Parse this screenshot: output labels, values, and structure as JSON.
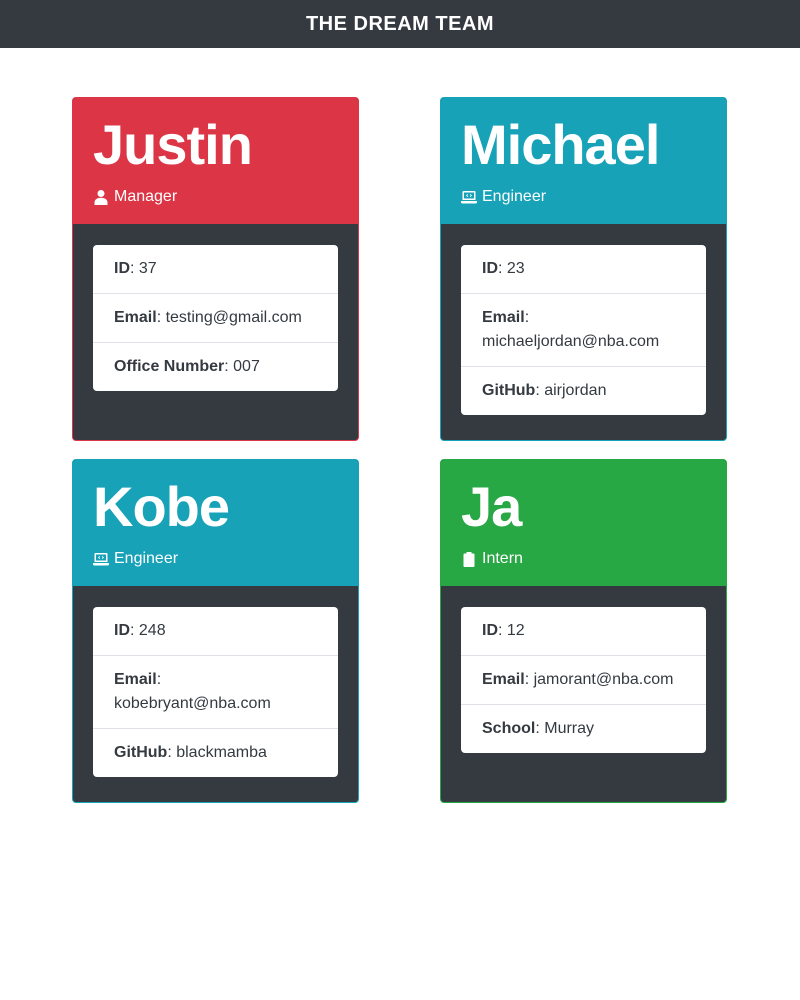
{
  "header": {
    "title": "THE DREAM TEAM"
  },
  "colors": {
    "manager": "#dc3545",
    "engineer": "#17a2b8",
    "intern": "#28a745",
    "card_body": "#343a40"
  },
  "cards": [
    {
      "name": "Justin",
      "role": "Manager",
      "role_icon": "manager-icon",
      "fields": [
        {
          "label": "ID",
          "value": "37"
        },
        {
          "label": "Email",
          "value": "testing@gmail.com"
        },
        {
          "label": "Office Number",
          "value": "007"
        }
      ]
    },
    {
      "name": "Michael",
      "role": "Engineer",
      "role_icon": "laptop-code-icon",
      "fields": [
        {
          "label": "ID",
          "value": "23"
        },
        {
          "label": "Email",
          "value": "michaeljordan@nba.com"
        },
        {
          "label": "GitHub",
          "value": "airjordan"
        }
      ]
    },
    {
      "name": "Kobe",
      "role": "Engineer",
      "role_icon": "laptop-code-icon",
      "fields": [
        {
          "label": "ID",
          "value": "248"
        },
        {
          "label": "Email",
          "value": "kobebryant@nba.com"
        },
        {
          "label": "GitHub",
          "value": "blackmamba"
        }
      ]
    },
    {
      "name": "Ja",
      "role": "Intern",
      "role_icon": "clipboard-icon",
      "fields": [
        {
          "label": "ID",
          "value": "12"
        },
        {
          "label": "Email",
          "value": "jamorant@nba.com"
        },
        {
          "label": "School",
          "value": "Murray"
        }
      ]
    }
  ]
}
